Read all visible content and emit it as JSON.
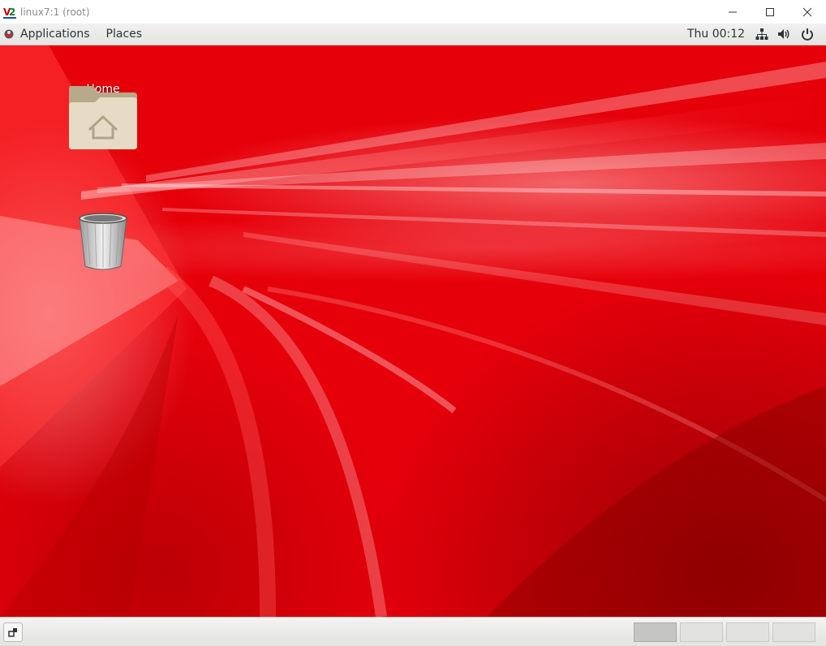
{
  "window": {
    "title": "linux7:1 (root)",
    "app_icon": "vnc-logo-icon",
    "controls": [
      "minimize-icon",
      "maximize-icon",
      "close-icon"
    ]
  },
  "top_panel": {
    "menus": [
      {
        "label": "Applications",
        "icon": "applications-icon"
      },
      {
        "label": "Places"
      }
    ],
    "clock": "Thu 00:12",
    "tray": [
      "network-icon",
      "volume-icon",
      "power-icon"
    ]
  },
  "desktop": {
    "icons": [
      {
        "label": "Home",
        "icon": "home-folder-icon"
      },
      {
        "label": "Trash",
        "icon": "trash-icon"
      }
    ],
    "wallpaper_color": "#e6000a"
  },
  "bottom_panel": {
    "show_desktop": "show-desktop-icon",
    "workspaces": 4,
    "active_workspace": 1
  }
}
